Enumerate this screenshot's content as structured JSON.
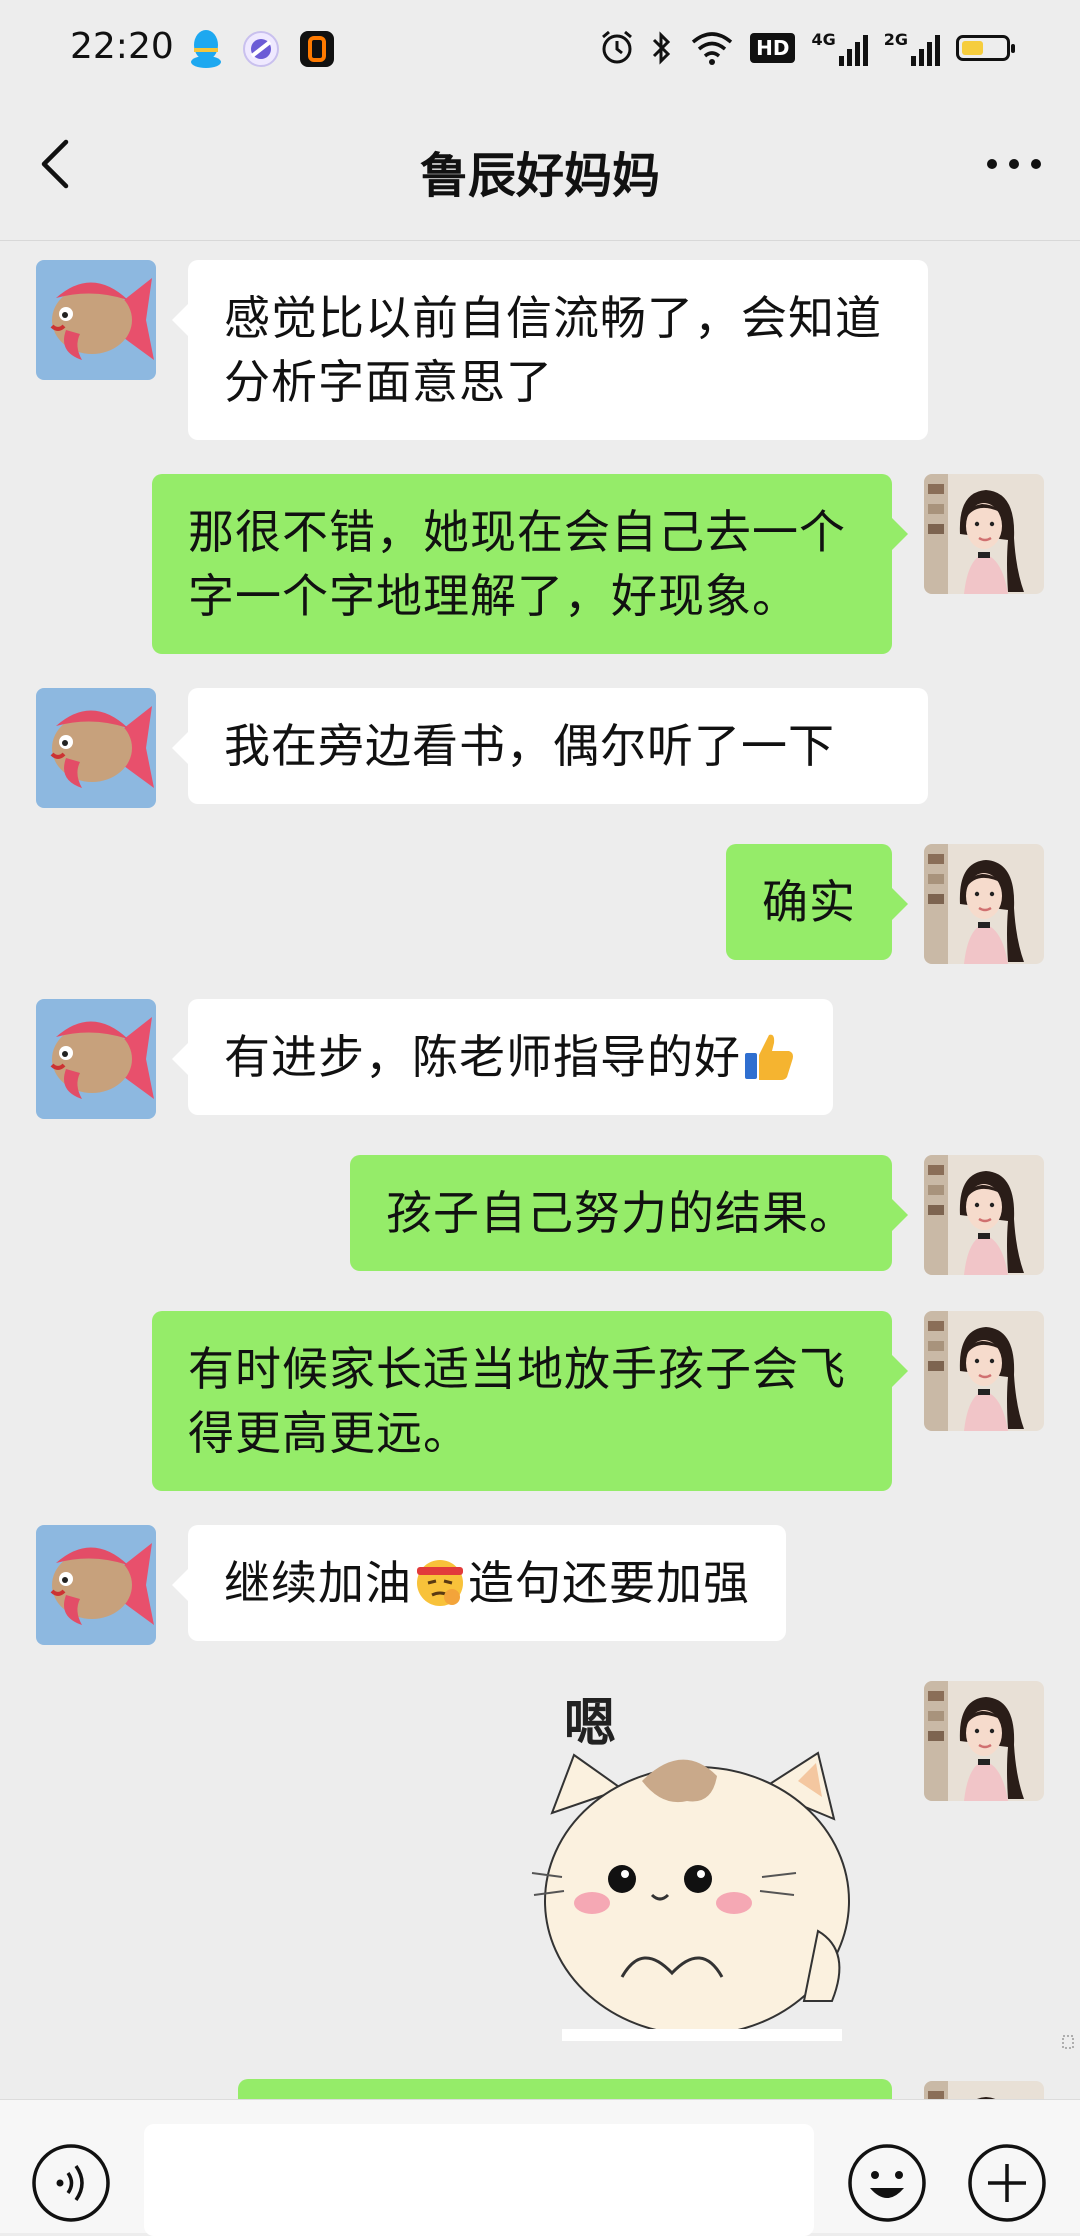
{
  "status_bar": {
    "time": "22:20",
    "app_icons": [
      "qq-penguin-icon",
      "browser-icon",
      "notification-app-icon"
    ],
    "system_icons": [
      "alarm-icon",
      "bluetooth-icon",
      "wifi-icon",
      "hd-icon",
      "signal-4g-icon",
      "signal-2g-icon",
      "battery-icon"
    ],
    "hd_label": "HD",
    "net_4g_label": "4G",
    "net_2g_label": "2G",
    "battery_level": 0.5
  },
  "nav": {
    "back_icon": "chevron-left-icon",
    "title": "鲁辰好妈妈",
    "more_icon": "more-dots-icon"
  },
  "messages": [
    {
      "side": "in",
      "text": "感觉比以前自信流畅了，会知道分析字面意思了"
    },
    {
      "side": "out",
      "text": "那很不错，她现在会自己去一个字一个字地理解了，好现象。"
    },
    {
      "side": "in",
      "text": "我在旁边看书，偶尔听了一下"
    },
    {
      "side": "out",
      "text": "确实"
    },
    {
      "side": "in",
      "text": "有进步，陈老师指导的好",
      "emoji": "thumbs-up-icon"
    },
    {
      "side": "out",
      "text": "孩子自己努力的结果。"
    },
    {
      "side": "out",
      "text": "有时候家长适当地放手孩子会飞得更高更远。"
    },
    {
      "side": "in",
      "text_before": "继续加油",
      "emoji": "headband-face-icon",
      "text_after": "造句还要加强"
    },
    {
      "side": "out",
      "type": "sticker",
      "caption": "嗯",
      "sticker": "cat-sticker-icon"
    }
  ],
  "input_bar": {
    "voice_icon": "voice-icon",
    "input_value": "",
    "emoji_icon": "smiley-icon",
    "plus_icon": "plus-icon"
  },
  "colors": {
    "background": "#ededed",
    "outgoing_bubble": "#95ec69",
    "incoming_bubble": "#ffffff"
  }
}
